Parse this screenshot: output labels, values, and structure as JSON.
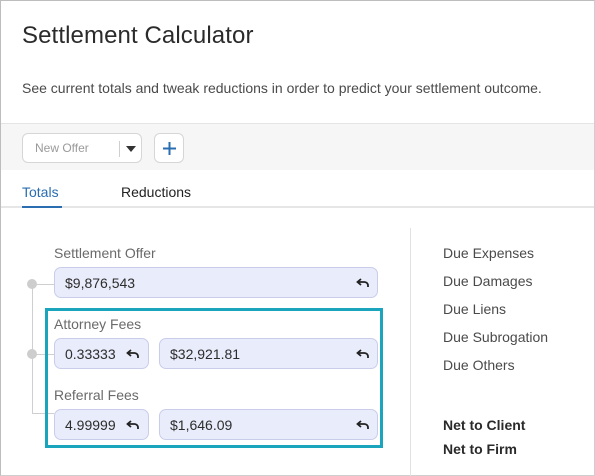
{
  "header": {
    "title": "Settlement Calculator",
    "subtitle": "See current totals and tweak reductions in order to predict your settlement outcome."
  },
  "toolbar": {
    "offer_select_placeholder": "New Offer",
    "add_icon": "plus-icon"
  },
  "tabs": [
    {
      "label": "Totals",
      "active": true
    },
    {
      "label": "Reductions",
      "active": false
    }
  ],
  "totals": {
    "settlement_offer": {
      "label": "Settlement Offer",
      "value": "$9,876,543"
    },
    "attorney_fees": {
      "label": "Attorney Fees",
      "rate": "0.33333",
      "amount": "$32,921.81"
    },
    "referral_fees": {
      "label": "Referral Fees",
      "rate": "4.99999",
      "amount": "$1,646.09"
    }
  },
  "summary": {
    "items": [
      "Due Expenses",
      "Due Damages",
      "Due Liens",
      "Due Subrogation",
      "Due Others"
    ],
    "net_client": "Net to Client",
    "net_firm": "Net to Firm"
  },
  "colors": {
    "accent": "#2a6db0",
    "highlight": "#1aa5bd",
    "field_bg": "#e9ecfb"
  }
}
